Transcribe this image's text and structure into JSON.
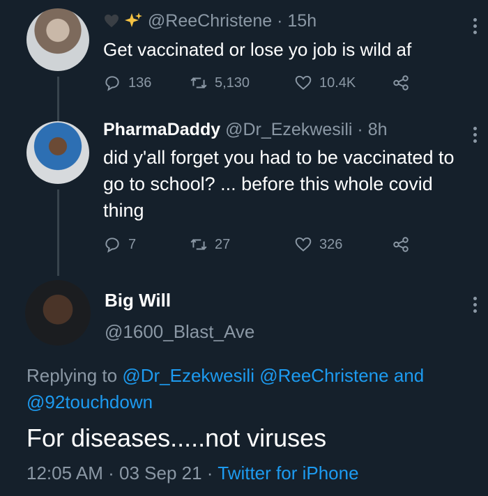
{
  "tweet1": {
    "display_name": "",
    "handle": "@ReeChristene",
    "time": "15h",
    "text": "Get vaccinated or lose yo job is wild af",
    "replies": "136",
    "retweets": "5,130",
    "likes": "10.4K"
  },
  "tweet2": {
    "display_name": "PharmaDaddy",
    "handle": "@Dr_Ezekwesili",
    "time": "8h",
    "text": "did y'all forget you had to be vaccinated to go to school? ... before this whole covid thing",
    "replies": "7",
    "retweets": "27",
    "likes": "326"
  },
  "main": {
    "display_name": "Big Will",
    "handle": "@1600_Blast_Ave",
    "replying_prefix": "Replying to",
    "mentions": [
      "@Dr_Ezekwesili",
      "@ReeChristene",
      "@92touchdown"
    ],
    "and_word": "and",
    "text": "For diseases.....not viruses",
    "time": "12:05 AM",
    "date": "03 Sep 21",
    "source": "Twitter for iPhone"
  },
  "colors": {
    "background": "#15202b",
    "secondary_text": "#8b98a5",
    "link": "#1d9bf0",
    "thread_line": "#38444d"
  }
}
